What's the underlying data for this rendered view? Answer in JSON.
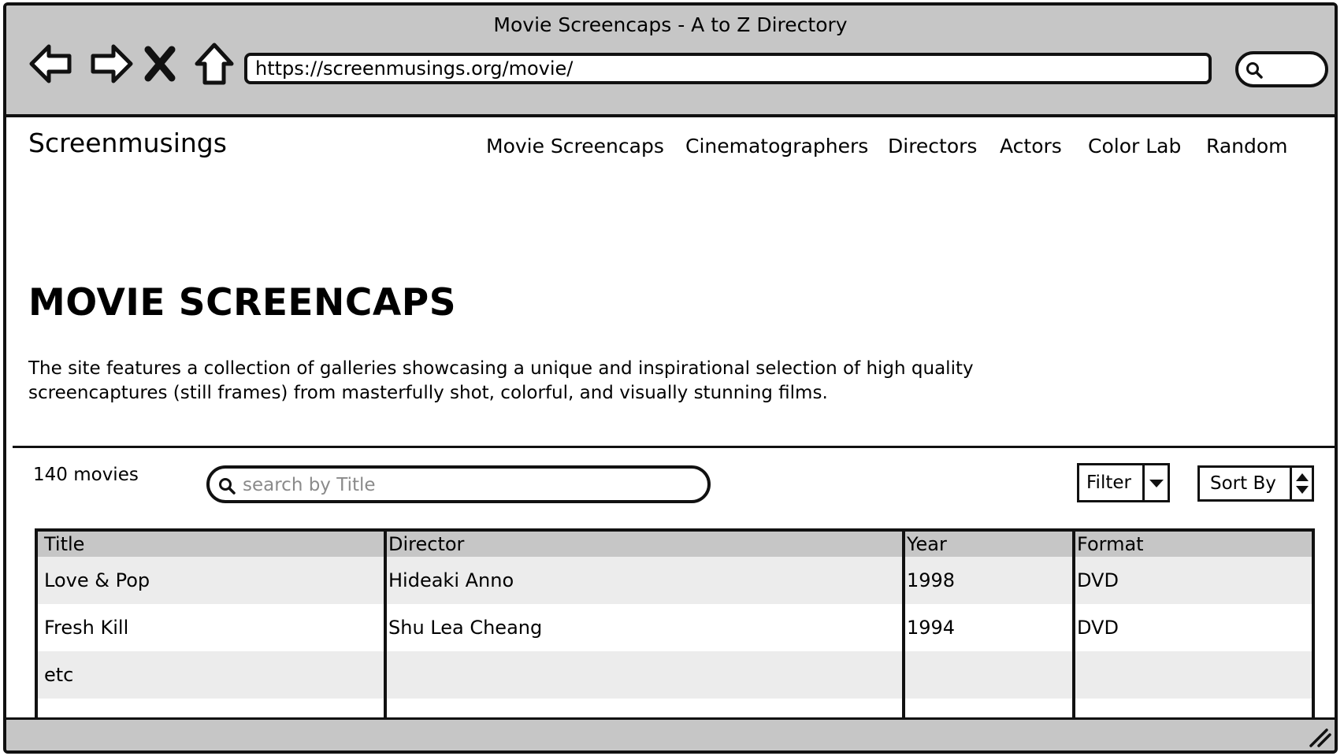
{
  "window": {
    "title": "Movie Screencaps - A to Z Directory",
    "url": "https://screenmusings.org/movie/"
  },
  "site": {
    "logo": "Screenmusings",
    "nav": [
      "Movie Screencaps",
      "Cinematographers",
      "Directors",
      "Actors",
      "Color Lab",
      "Random"
    ]
  },
  "page": {
    "heading": "MOVIE SCREENCAPS",
    "description_line1": "The site features a collection of galleries showcasing a unique and inspirational selection of high quality",
    "description_line2": "screencaptures (still frames) from masterfully shot, colorful, and visually stunning films."
  },
  "controls": {
    "count": "140 movies",
    "search_placeholder": "search by Title",
    "filter_label": "Filter",
    "sort_label": "Sort By"
  },
  "table": {
    "columns": [
      "Title",
      "Director",
      "Year",
      "Format"
    ],
    "rows": [
      [
        "Love & Pop",
        "Hideaki Anno",
        "1998",
        "DVD"
      ],
      [
        "Fresh Kill",
        "Shu Lea Cheang",
        "1994",
        "DVD"
      ],
      [
        "etc",
        "",
        "",
        ""
      ],
      [
        "",
        "",
        "",
        ""
      ]
    ]
  },
  "icons": {
    "back": "back-arrow-icon",
    "forward": "forward-arrow-icon",
    "stop": "close-icon",
    "home": "home-icon",
    "search": "search-icon",
    "filter_dropdown": "chevron-down-icon",
    "sort": "sort-arrows-icon",
    "resize": "resize-grip-icon"
  }
}
